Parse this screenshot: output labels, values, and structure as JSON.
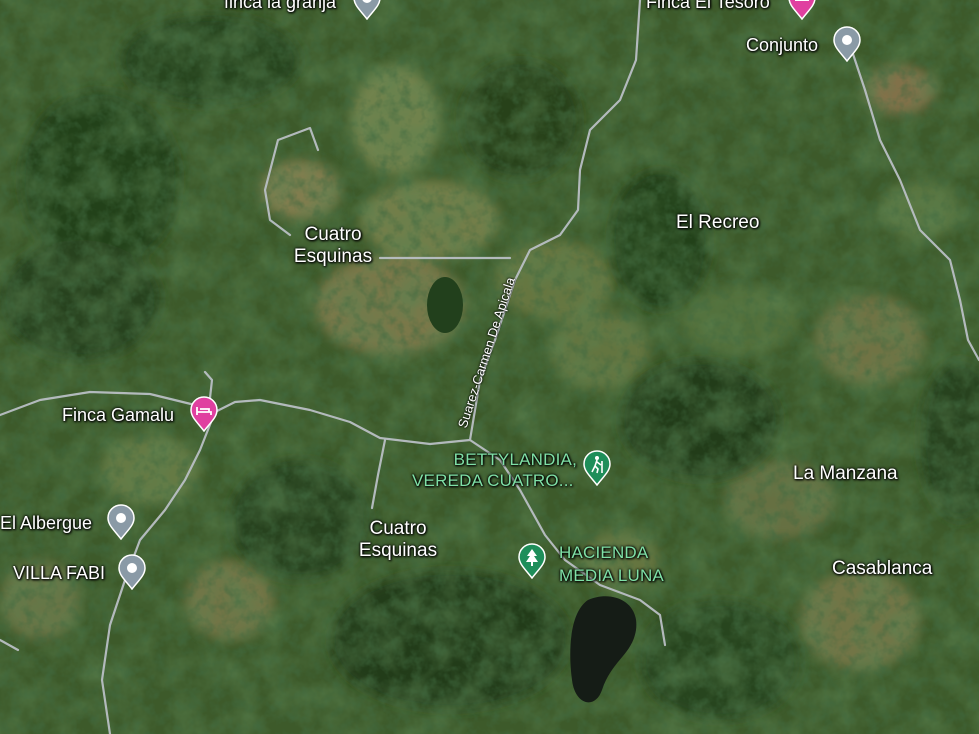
{
  "map": {
    "type": "satellite",
    "places": {
      "cuatro_esquinas_1": "Cuatro\nEsquinas",
      "cuatro_esquinas_2": "Cuatro\nEsquinas",
      "el_recreo": "El Recreo",
      "la_manzana": "La Manzana",
      "casablanca": "Casablanca"
    },
    "road": "Suarez-Carmen De Apicala",
    "pois": {
      "finca_la_granja": "finca la granja",
      "finca_el_tesoro": "Finca El Tesoro",
      "conjunto": "Conjunto",
      "finca_gamalu": "Finca Gamalu",
      "el_albergue": "El Albergue",
      "villa_fabi": "VILLA FABI",
      "bettylandia_line1": "BETTYLANDIA,",
      "bettylandia_line2": "VEREDA CUATRO...",
      "hacienda_line1": "HACIENDA",
      "hacienda_line2": "MEDIA LUNA"
    },
    "icons": {
      "grey_pin": "location-pin-icon",
      "hotel_pin": "hotel-bed-icon",
      "hiking_pin": "hiking-icon",
      "park_pin": "tree-icon"
    },
    "colors": {
      "grey_pin": "#8a9aa6",
      "hotel_pin": "#e040a0",
      "green_pin": "#1e8e5a",
      "green_text": "#7fe0a6"
    }
  }
}
